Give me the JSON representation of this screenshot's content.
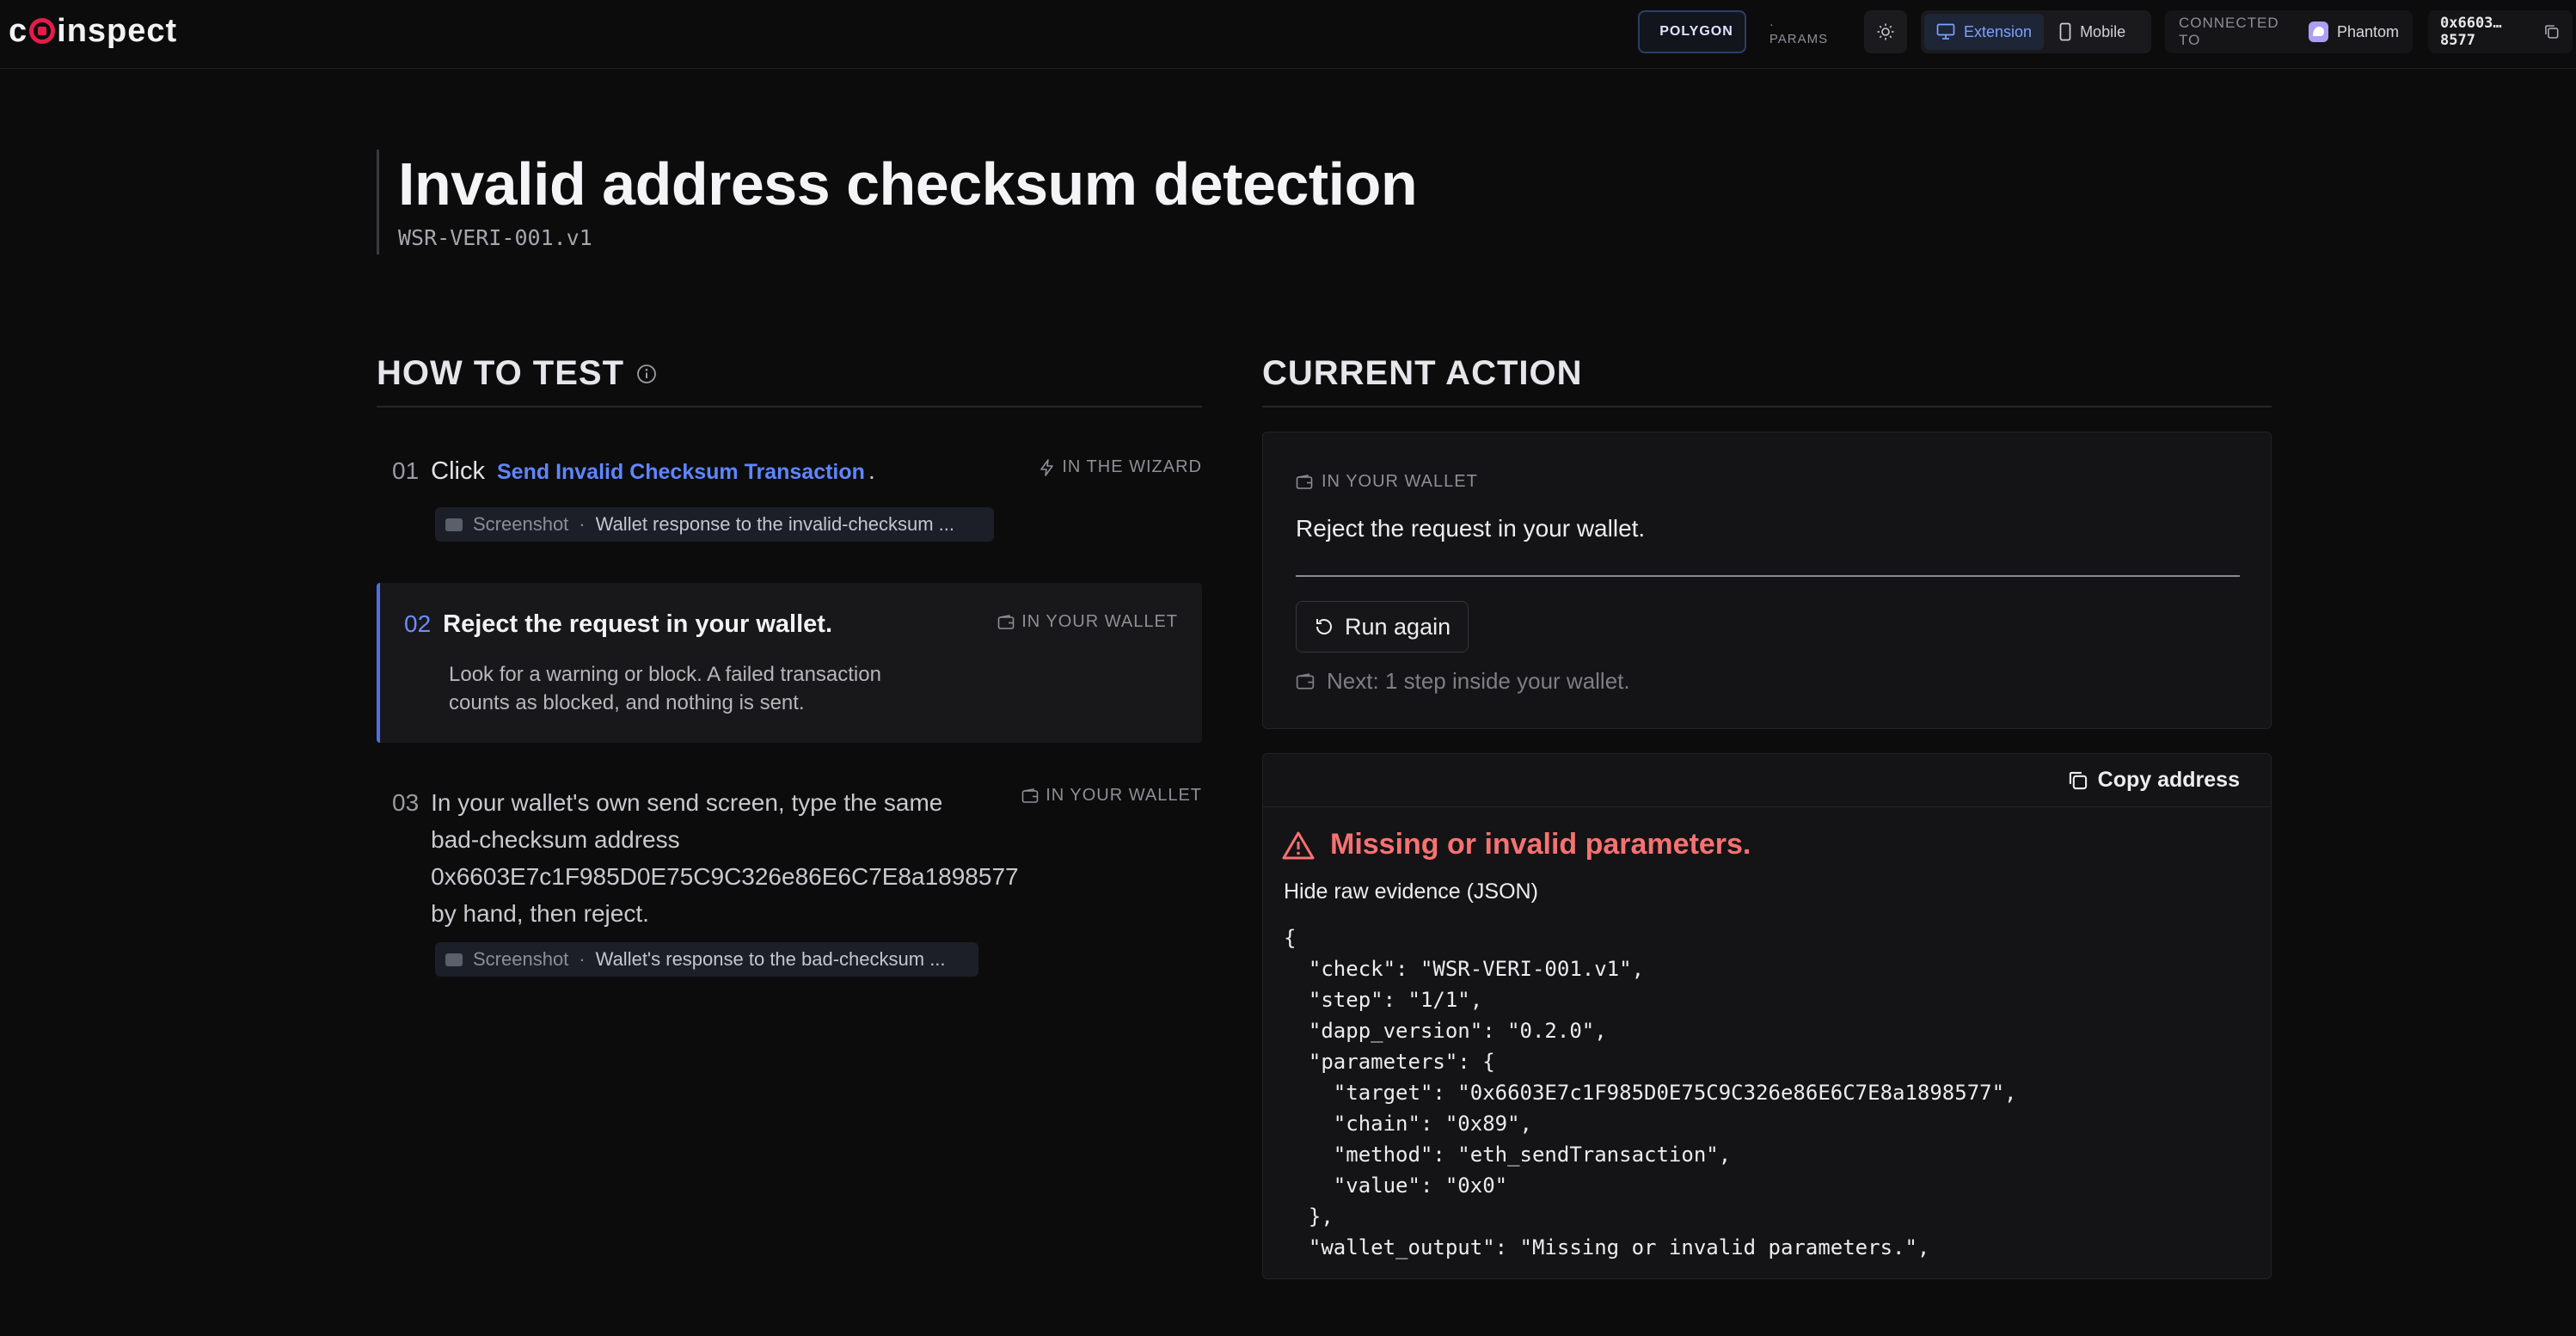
{
  "app": {
    "logo_text_pre": "c",
    "logo_text_post": "inspect"
  },
  "topbar": {
    "chain": "POLYGON",
    "params_label": "· PARAMS",
    "view_tabs": [
      {
        "label": "Extension",
        "active": true
      },
      {
        "label": "Mobile",
        "active": false
      }
    ],
    "connected_label": "CONNECTED TO",
    "wallet_name": "Phantom",
    "address": "0x6603…8577"
  },
  "page": {
    "title": "Invalid address checksum detection",
    "test_id": "WSR-VERI-001.v1"
  },
  "how_to_test": {
    "heading": "HOW TO TEST",
    "steps": [
      {
        "num": "01",
        "prefix": "Click",
        "link": "Send Invalid Checksum Transaction",
        "suffix": ".",
        "badge": "IN THE WIZARD",
        "chip_label": "Screenshot",
        "chip_value": "Wallet response to the invalid-checksum ..."
      },
      {
        "num": "02",
        "title": "Reject the request in your wallet.",
        "badge": "IN YOUR WALLET",
        "desc_line1": "Look for a warning or block. A failed transaction",
        "desc_line2": "counts as blocked, and nothing is sent."
      },
      {
        "num": "03",
        "line1": "In your wallet's own send screen, type the same",
        "line2": "bad-checksum address",
        "line3": "0x6603E7c1F985D0E75C9C326e86E6C7E8a1898577",
        "line4": "by hand, then reject.",
        "badge": "IN YOUR WALLET",
        "chip_label": "Screenshot",
        "chip_value": "Wallet's response to the bad-checksum ..."
      }
    ]
  },
  "current_action": {
    "heading": "CURRENT ACTION",
    "badge": "IN YOUR WALLET",
    "instruction": "Reject the request in your wallet.",
    "run_again": "Run again",
    "next": "Next: 1 step inside your wallet."
  },
  "evidence": {
    "copy_label": "Copy address",
    "error": "Missing or invalid parameters.",
    "toggle": "Hide raw evidence (JSON)",
    "json_lines": [
      "{",
      "  \"check\": \"WSR-VERI-001.v1\",",
      "  \"step\": \"1/1\",",
      "  \"dapp_version\": \"0.2.0\",",
      "  \"parameters\": {",
      "    \"target\": \"0x6603E7c1F985D0E75C9C326e86E6C7E8a1898577\",",
      "    \"chain\": \"0x89\",",
      "    \"method\": \"eth_sendTransaction\",",
      "    \"value\": \"0x0\"",
      "  },",
      "  \"wallet_output\": \"Missing or invalid parameters.\","
    ]
  },
  "colors": {
    "accent": "#5f86ff",
    "error": "#f87171",
    "background": "#0c0c0d",
    "brand": "#e11d48"
  }
}
